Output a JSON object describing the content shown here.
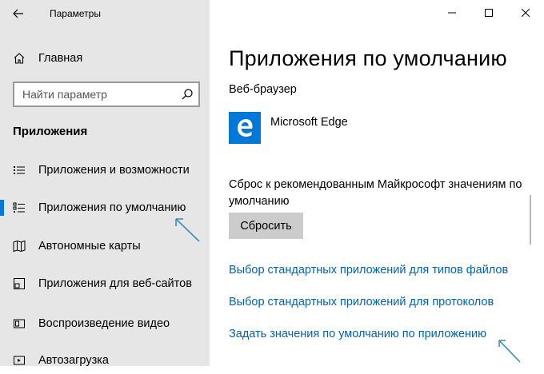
{
  "window": {
    "title": "Параметры",
    "controls": [
      "minimize",
      "maximize",
      "close"
    ]
  },
  "sidebar": {
    "home_label": "Главная",
    "search": {
      "placeholder": "Найти параметр",
      "value": ""
    },
    "section_title": "Приложения",
    "items": [
      {
        "label": "Приложения и возможности",
        "icon": "list-icon",
        "active": false
      },
      {
        "label": "Приложения по умолчанию",
        "icon": "default-apps-icon",
        "active": true
      },
      {
        "label": "Автономные карты",
        "icon": "map-icon",
        "active": false
      },
      {
        "label": "Приложения для веб-сайтов",
        "icon": "website-apps-icon",
        "active": false
      },
      {
        "label": "Воспроизведение видео",
        "icon": "video-icon",
        "active": false
      },
      {
        "label": "Автозагрузка",
        "icon": "startup-icon",
        "active": false
      }
    ]
  },
  "main": {
    "title": "Приложения по умолчанию",
    "browser_label": "Веб-браузер",
    "browser_app": "Microsoft Edge",
    "reset_text": "Сброс к рекомендованным Майкрософт значениям по умолчанию",
    "reset_button": "Сбросить",
    "links": [
      "Выбор стандартных приложений для типов файлов",
      "Выбор стандартных приложений для протоколов",
      "Задать значения по умолчанию по приложению"
    ]
  },
  "colors": {
    "accent": "#0078d7",
    "link": "#0063b1",
    "sidebar_bg": "#e6e6e6",
    "annotation_arrow": "#3a8fb7"
  }
}
